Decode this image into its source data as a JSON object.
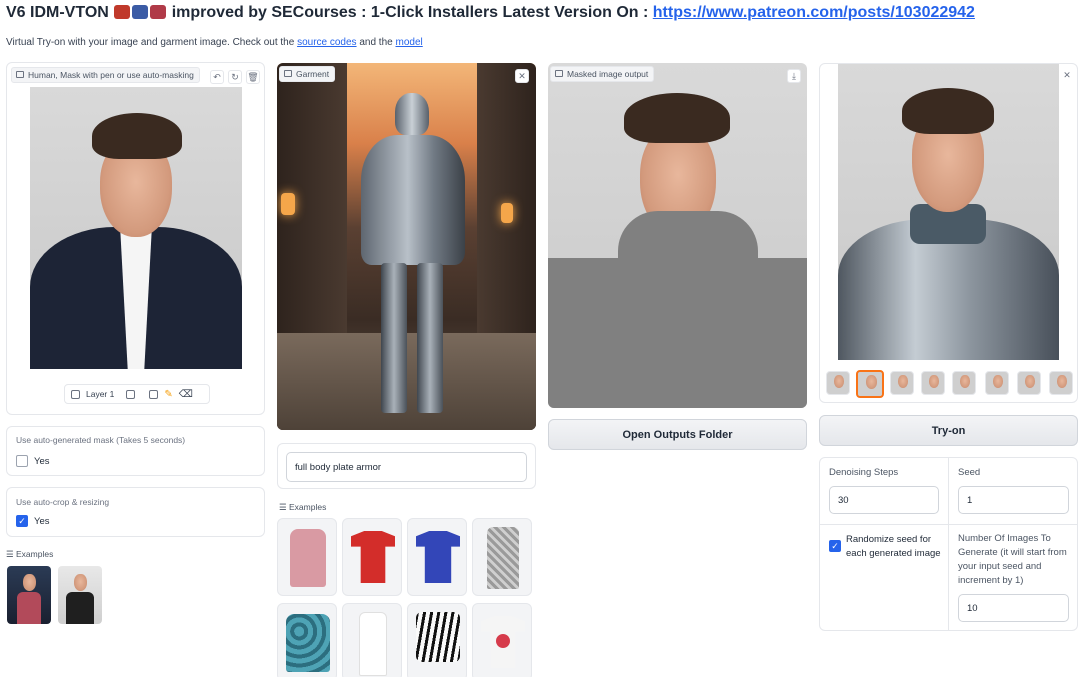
{
  "header": {
    "title_prefix": "V6 IDM-VTON",
    "title_mid": "improved by SECourses : 1-Click Installers Latest Version On :",
    "title_link": "https://www.patreon.com/posts/103022942",
    "subtitle_prefix": "Virtual Try-on with your image and garment image. Check out the",
    "subtitle_link1": "source codes",
    "subtitle_and": "and the",
    "subtitle_link2": "model"
  },
  "human_panel": {
    "label": "Human, Mask with pen or use auto-masking",
    "toolbar_layer": "Layer 1"
  },
  "auto_mask": {
    "label": "Use auto-generated mask (Takes 5 seconds)",
    "option": "Yes",
    "checked": false
  },
  "auto_crop": {
    "label": "Use auto-crop & resizing",
    "option": "Yes",
    "checked": true
  },
  "human_examples": {
    "label": "Examples"
  },
  "garment_panel": {
    "label": "Garment",
    "description": "full body plate armor"
  },
  "garment_examples": {
    "label": "Examples"
  },
  "masked_panel": {
    "label": "Masked image output",
    "button": "Open Outputs Folder"
  },
  "output_panel": {
    "button": "Try-on"
  },
  "settings": {
    "denoising_label": "Denoising Steps",
    "denoising_value": "30",
    "seed_label": "Seed",
    "seed_value": "1",
    "randomize_label": "Randomize seed for each generated image",
    "randomize_checked": true,
    "num_images_label": "Number Of Images To Generate (it will start from your input seed and increment by 1)",
    "num_images_value": "10"
  },
  "icons": {
    "close": "close-icon",
    "download": "download-icon",
    "undo": "undo-icon",
    "redo": "redo-icon",
    "trash": "trash-icon",
    "check": "check-icon"
  },
  "colors": {
    "link": "#2563eb",
    "checkbox_on": "#2563eb",
    "selected_thumb": "#f97316"
  }
}
